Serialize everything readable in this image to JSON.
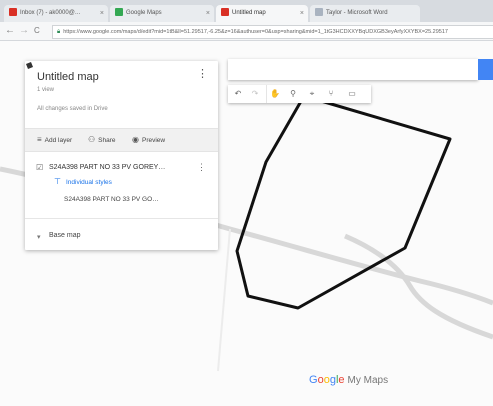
{
  "browser": {
    "tabs": [
      {
        "label": "Inbox (7) - ak0000@…",
        "favicon_color": "#d93025"
      },
      {
        "label": "Google Maps",
        "favicon_color": "#34a853"
      },
      {
        "label": "Untitled map",
        "favicon_color": "#d93025"
      },
      {
        "label": "Taylor - Microsoft Word",
        "favicon_color": "#a9b3c0"
      }
    ],
    "nav": {
      "back": "←",
      "forward": "→",
      "reload": "C"
    },
    "url": "https://www.google.com/maps/d/edit?mid=1tB&ll=51.29517,-6.25&z=16&authuser=0&usp=sharing&mid=1_1tG3HCDXXYBqUDXGB3eyArfyXXYBX=25.29517"
  },
  "panel": {
    "title": "Untitled map",
    "views": "1 view",
    "saved_status": "All changes saved in Drive",
    "actions": [
      {
        "icon": "≡",
        "label": "Add layer"
      },
      {
        "icon": "⚇",
        "label": "Share"
      },
      {
        "icon": "◉",
        "label": "Preview"
      }
    ],
    "layer": {
      "title": "S24A398 PART NO 33 PV GOREY…",
      "styles_link": "Individual styles",
      "shape_label": "S24A398 PART NO 33 PV GO…"
    },
    "basemap": "Base map"
  },
  "search": {
    "placeholder": ""
  },
  "toolbar": {
    "tools": [
      "↶",
      "↷",
      "✋",
      "⚲",
      "⌖",
      "⑂",
      "▭"
    ]
  },
  "branding": {
    "g": "G",
    "o1": "o",
    "o2": "o",
    "g2": "g",
    "l": "l",
    "e": "e",
    "rest": "My Maps"
  },
  "colors": {
    "polygon": "#111111",
    "road": "#d8d8d8",
    "accent": "#4285f4"
  }
}
